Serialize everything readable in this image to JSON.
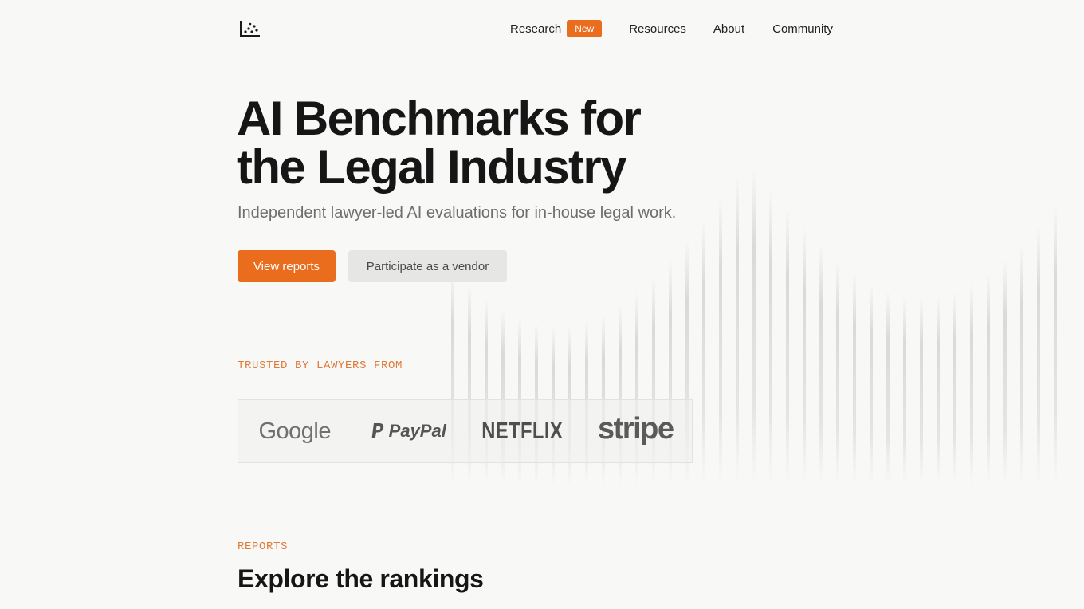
{
  "header": {
    "logo": "scatter-chart-logo",
    "nav": [
      {
        "label": "Research",
        "badge": "New"
      },
      {
        "label": "Resources"
      },
      {
        "label": "About"
      },
      {
        "label": "Community"
      }
    ]
  },
  "hero": {
    "title_line1": "AI Benchmarks for",
    "title_line2": "the Legal Industry",
    "subtitle": "Independent lawyer-led AI evaluations for in-house legal work.",
    "primary_button": "View reports",
    "secondary_button": "Participate as a vendor"
  },
  "trusted": {
    "eyebrow": "TRUSTED BY LAWYERS FROM",
    "logos": [
      "Google",
      "PayPal",
      "NETFLIX",
      "stripe"
    ]
  },
  "reports": {
    "eyebrow": "REPORTS",
    "title": "Explore the rankings"
  },
  "colors": {
    "accent": "#ea6d1e",
    "background": "#f8f8f7",
    "text": "#161616"
  }
}
